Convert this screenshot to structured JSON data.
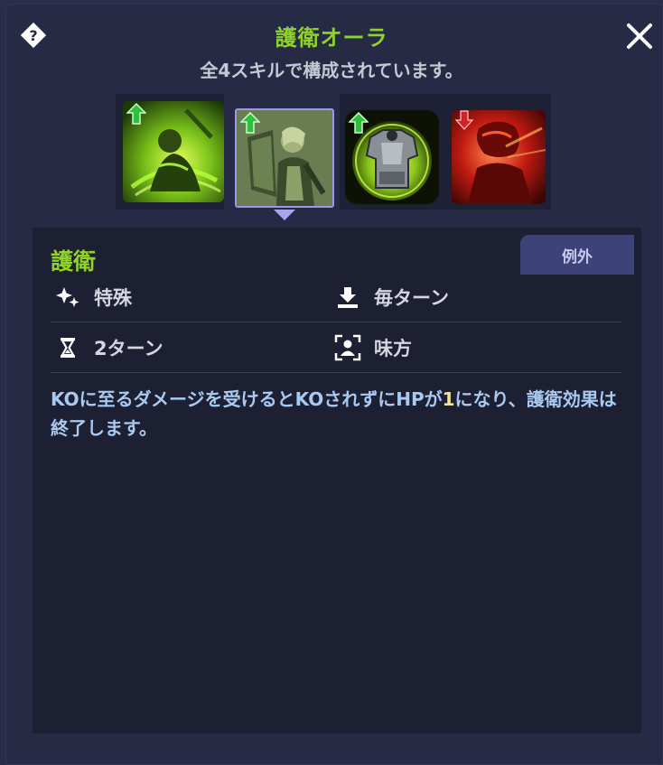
{
  "dialog": {
    "title": "護衛オーラ",
    "subtitle": "全4スキルで構成されています。"
  },
  "skills": [
    {
      "icon": "green-warrior-skill-icon",
      "buff": "up"
    },
    {
      "icon": "shield-knight-skill-icon",
      "buff": "up",
      "selected": true
    },
    {
      "icon": "armor-skill-icon",
      "buff": "up"
    },
    {
      "icon": "red-warrior-skill-icon",
      "buff": "down"
    }
  ],
  "detail": {
    "name": "護衛",
    "exception_tab": "例外",
    "category": "特殊",
    "timing": "毎ターン",
    "duration": "2ターン",
    "target": "味方",
    "description_before": "KOに至るダメージを受けるとKOされずにHPが",
    "description_number": "1",
    "description_after": "になり、護衛効果は終了します。"
  },
  "colors": {
    "title_green": "#8ed22a",
    "description_blue": "#a9c9f0",
    "highlight_yellow": "#f4e39c",
    "tab_purple": "#3d4378",
    "buff_up": "#2fbf3a",
    "buff_down": "#d3212c"
  }
}
